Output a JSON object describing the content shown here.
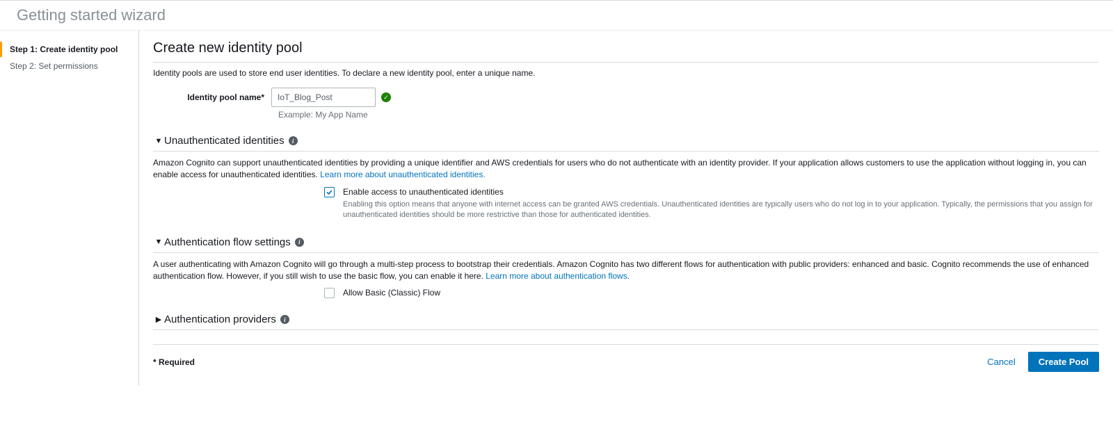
{
  "header": {
    "wizard_title": "Getting started wizard"
  },
  "sidebar": {
    "steps": [
      {
        "label": "Step 1: Create identity pool",
        "active": true
      },
      {
        "label": "Step 2: Set permissions",
        "active": false
      }
    ]
  },
  "main": {
    "heading": "Create new identity pool",
    "intro": "Identity pools are used to store end user identities. To declare a new identity pool, enter a unique name.",
    "pool_name": {
      "label": "Identity pool name*",
      "value": "IoT_Blog_Post",
      "example": "Example: My App Name",
      "valid": "✓"
    }
  },
  "sections": {
    "unauth": {
      "title": "Unauthenticated identities",
      "expanded": true,
      "desc_prefix": "Amazon Cognito can support unauthenticated identities by providing a unique identifier and AWS credentials for users who do not authenticate with an identity provider. If your application allows customers to use the application without logging in, you can enable access for unauthenticated identities. ",
      "link": "Learn more about unauthenticated identities.",
      "checkbox": {
        "checked": true,
        "label": "Enable access to unauthenticated identities",
        "hint": "Enabling this option means that anyone with internet access can be granted AWS credentials. Unauthenticated identities are typically users who do not log in to your application. Typically, the permissions that you assign for unauthenticated identities should be more restrictive than those for authenticated identities."
      }
    },
    "authflow": {
      "title": "Authentication flow settings",
      "expanded": true,
      "desc_prefix": "A user authenticating with Amazon Cognito will go through a multi-step process to bootstrap their credentials. Amazon Cognito has two different flows for authentication with public providers: enhanced and basic. Cognito recommends the use of enhanced authentication flow. However, if you still wish to use the basic flow, you can enable it here. ",
      "link": "Learn more about authentication flows.",
      "checkbox": {
        "checked": false,
        "label": "Allow Basic (Classic) Flow"
      }
    },
    "providers": {
      "title": "Authentication providers",
      "expanded": false
    }
  },
  "footer": {
    "required": "* Required",
    "cancel": "Cancel",
    "create": "Create Pool"
  }
}
